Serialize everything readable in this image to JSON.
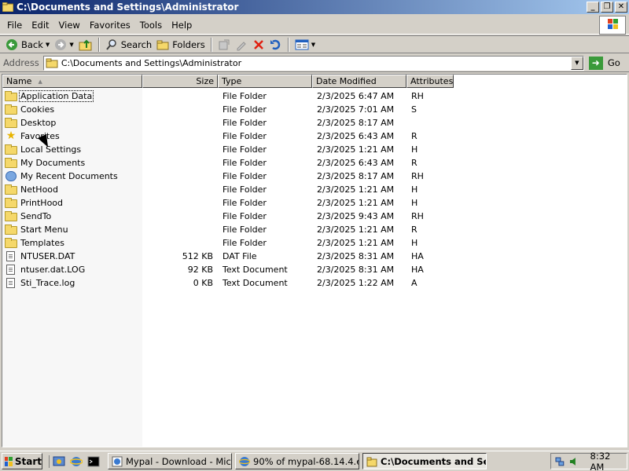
{
  "window": {
    "title": "C:\\Documents and Settings\\Administrator",
    "minimize": "_",
    "maximize": "❐",
    "close": "✕"
  },
  "menu": [
    "File",
    "Edit",
    "View",
    "Favorites",
    "Tools",
    "Help"
  ],
  "toolbar": {
    "back": "Back",
    "search": "Search",
    "folders": "Folders"
  },
  "address": {
    "label": "Address",
    "value": "C:\\Documents and Settings\\Administrator",
    "go": "Go"
  },
  "columns": [
    "Name",
    "Size",
    "Type",
    "Date Modified",
    "Attributes"
  ],
  "files": [
    {
      "name": "Application Data",
      "size": "",
      "type": "File Folder",
      "date": "2/3/2025 6:47 AM",
      "attr": "RH",
      "icon": "folder-icon"
    },
    {
      "name": "Cookies",
      "size": "",
      "type": "File Folder",
      "date": "2/3/2025 7:01 AM",
      "attr": "S",
      "icon": "folder-icon"
    },
    {
      "name": "Desktop",
      "size": "",
      "type": "File Folder",
      "date": "2/3/2025 8:17 AM",
      "attr": "",
      "icon": "folder-icon"
    },
    {
      "name": "Favorites",
      "size": "",
      "type": "File Folder",
      "date": "2/3/2025 6:43 AM",
      "attr": "R",
      "icon": "star-icon"
    },
    {
      "name": "Local Settings",
      "size": "",
      "type": "File Folder",
      "date": "2/3/2025 1:21 AM",
      "attr": "H",
      "icon": "folder-icon"
    },
    {
      "name": "My Documents",
      "size": "",
      "type": "File Folder",
      "date": "2/3/2025 6:43 AM",
      "attr": "R",
      "icon": "folder-icon"
    },
    {
      "name": "My Recent Documents",
      "size": "",
      "type": "File Folder",
      "date": "2/3/2025 8:17 AM",
      "attr": "RH",
      "icon": "recent-icon"
    },
    {
      "name": "NetHood",
      "size": "",
      "type": "File Folder",
      "date": "2/3/2025 1:21 AM",
      "attr": "H",
      "icon": "folder-icon"
    },
    {
      "name": "PrintHood",
      "size": "",
      "type": "File Folder",
      "date": "2/3/2025 1:21 AM",
      "attr": "H",
      "icon": "folder-icon"
    },
    {
      "name": "SendTo",
      "size": "",
      "type": "File Folder",
      "date": "2/3/2025 9:43 AM",
      "attr": "RH",
      "icon": "folder-icon"
    },
    {
      "name": "Start Menu",
      "size": "",
      "type": "File Folder",
      "date": "2/3/2025 1:21 AM",
      "attr": "R",
      "icon": "folder-icon"
    },
    {
      "name": "Templates",
      "size": "",
      "type": "File Folder",
      "date": "2/3/2025 1:21 AM",
      "attr": "H",
      "icon": "folder-icon"
    },
    {
      "name": "NTUSER.DAT",
      "size": "512 KB",
      "type": "DAT File",
      "date": "2/3/2025 8:31 AM",
      "attr": "HA",
      "icon": "file-icon"
    },
    {
      "name": "ntuser.dat.LOG",
      "size": "92 KB",
      "type": "Text Document",
      "date": "2/3/2025 8:31 AM",
      "attr": "HA",
      "icon": "text-file-icon"
    },
    {
      "name": "Sti_Trace.log",
      "size": "0 KB",
      "type": "Text Document",
      "date": "2/3/2025 1:22 AM",
      "attr": "A",
      "icon": "text-file-icon"
    }
  ],
  "taskbar": {
    "start": "Start",
    "tasks": [
      {
        "label": "Mypal - Download - Micro...",
        "active": false
      },
      {
        "label": "90% of mypal-68.14.4.e...",
        "active": false
      },
      {
        "label": "C:\\Documents and Se...",
        "active": true
      }
    ],
    "clock": "8:32 AM"
  },
  "colors": {
    "title_start": "#0a246a",
    "title_end": "#a6caf0",
    "face": "#d4d0c8",
    "folder": "#f5d86a"
  }
}
